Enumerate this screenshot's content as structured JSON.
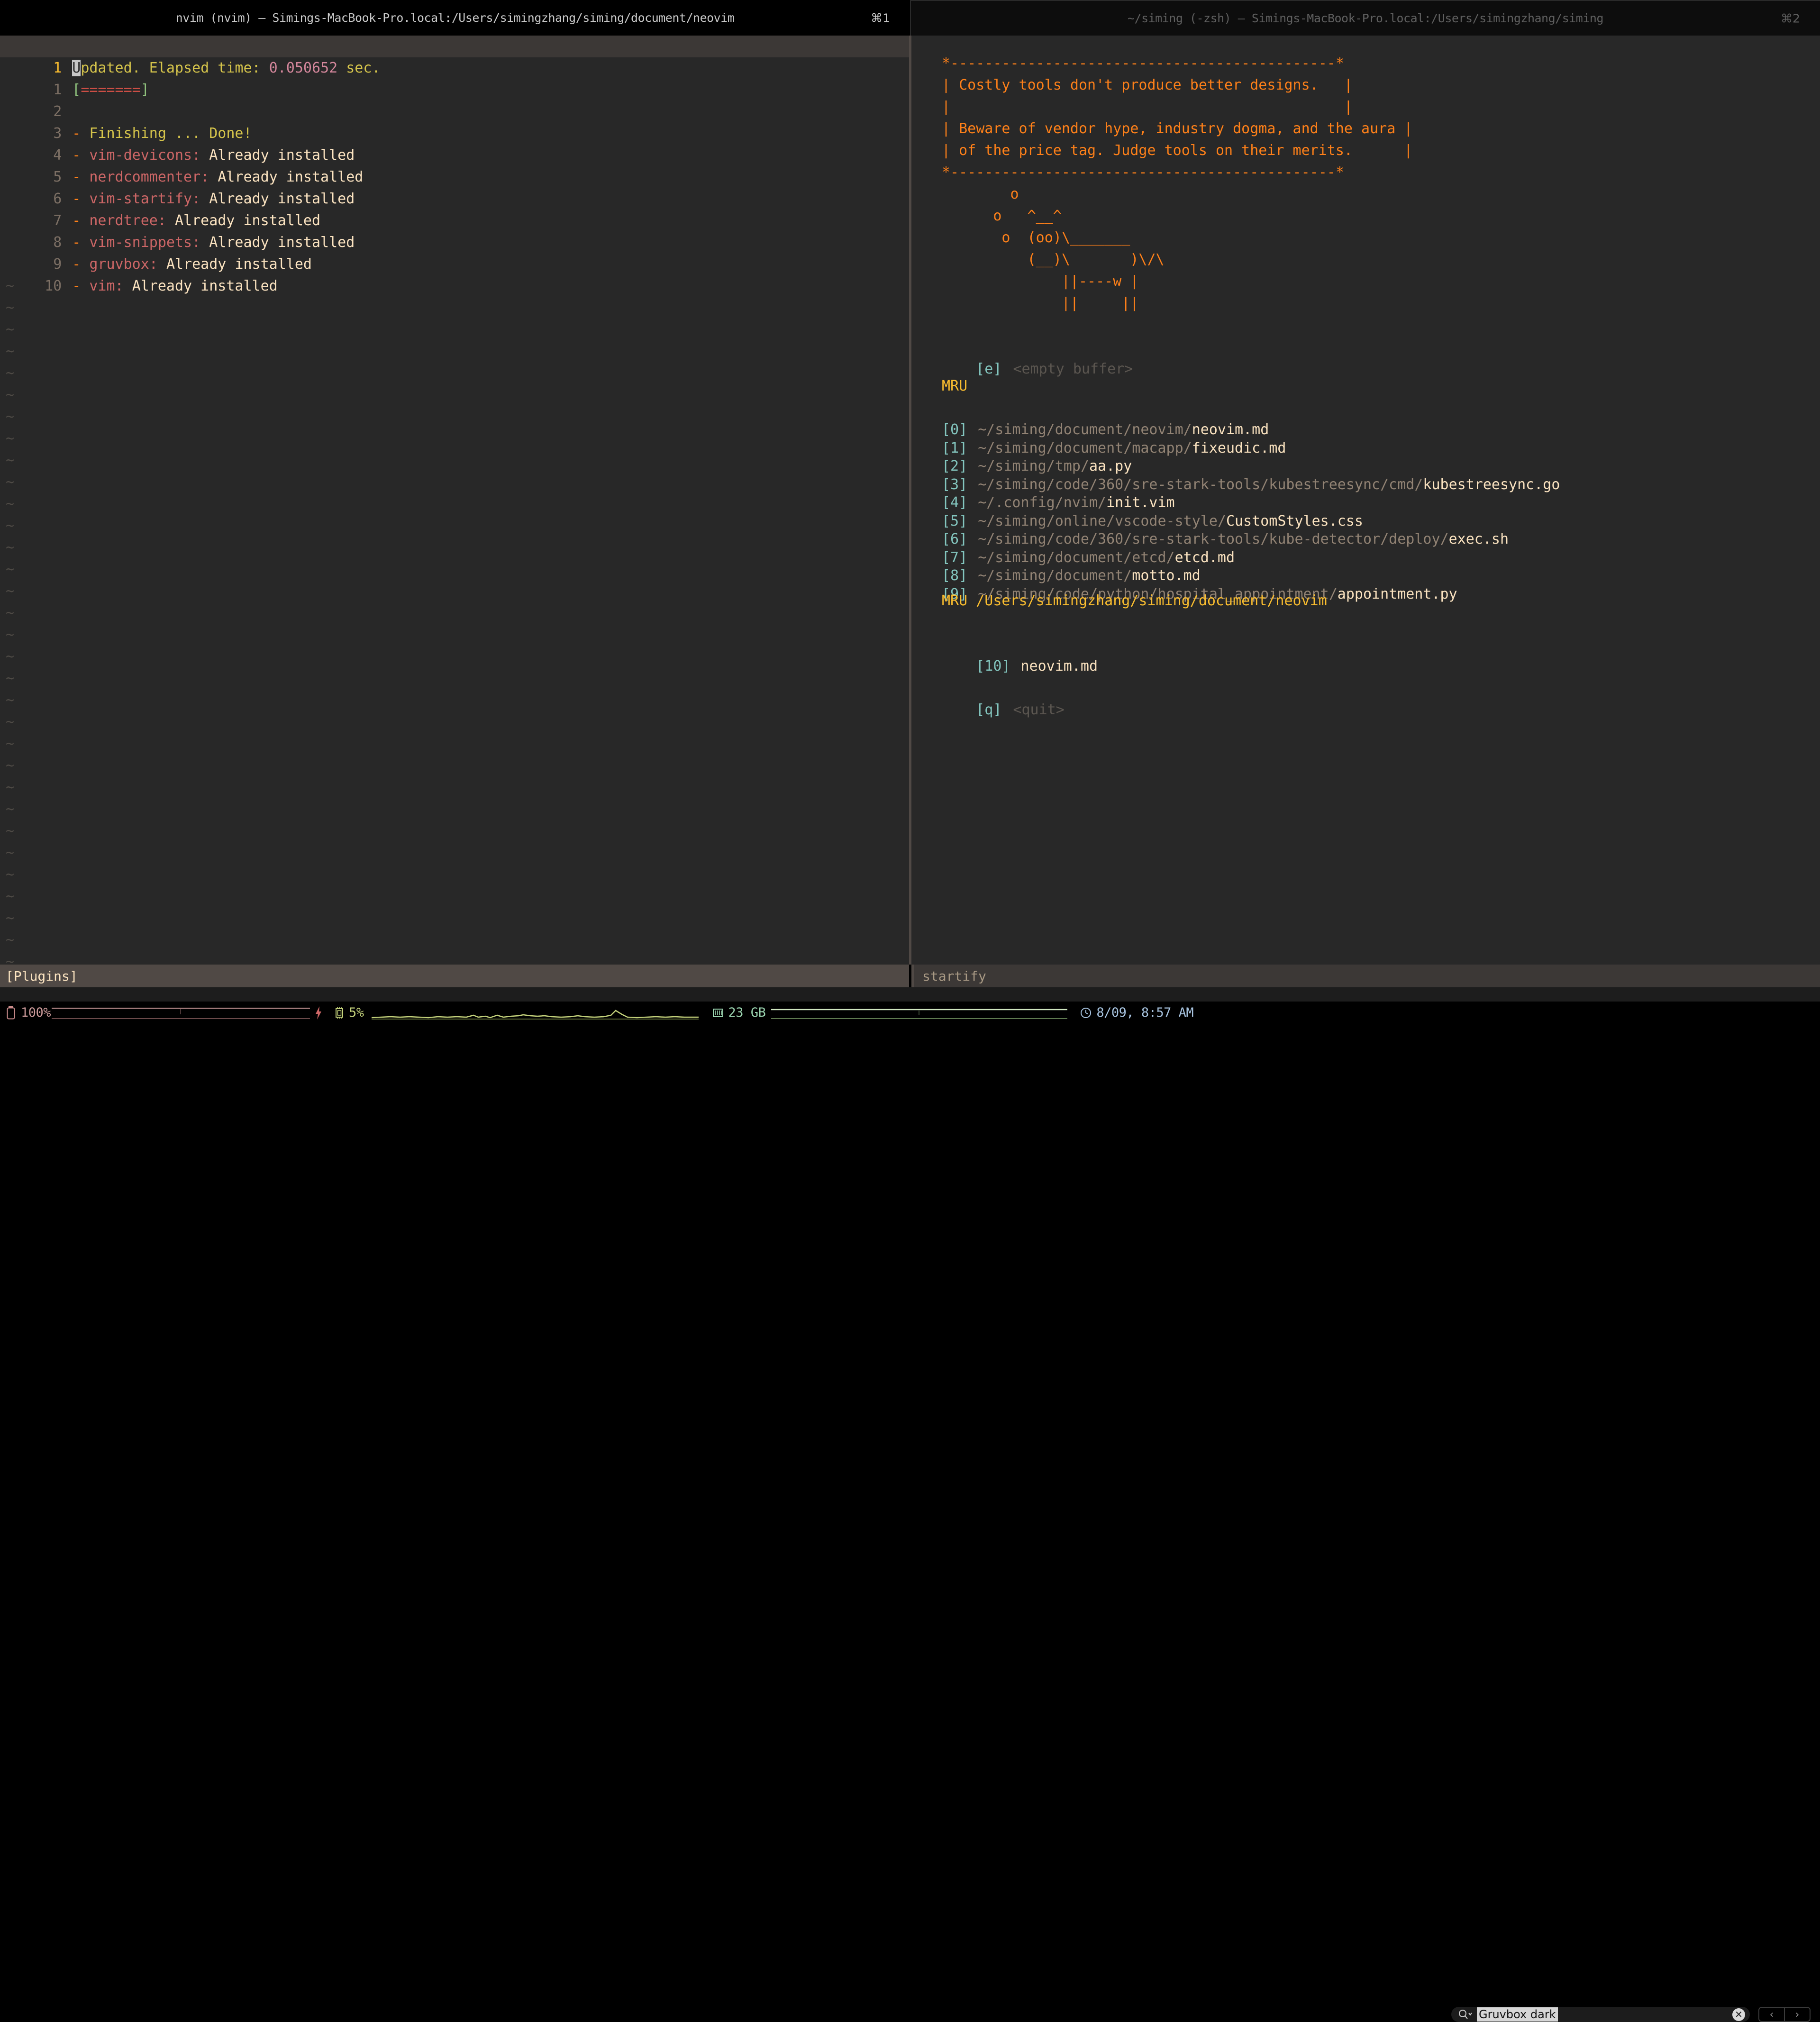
{
  "windows": {
    "left": {
      "title": "nvim (nvim) — Simings-MacBook-Pro.local:/Users/simingzhang/siming/document/neovim",
      "badge": "⌘1",
      "statusline": "[Plugins]"
    },
    "right": {
      "title": "~/siming (-zsh) — Simings-MacBook-Pro.local:/Users/simingzhang/siming",
      "badge": "⌘2",
      "statusline": "startify"
    }
  },
  "editor": {
    "cursor_line": {
      "number": "1",
      "cursor_char": "U",
      "text_after_cursor": "pdated. Elapsed time: ",
      "elapsed": "0.050652",
      "suffix": " sec."
    },
    "lines": [
      {
        "number": "1",
        "bracket_open": "[",
        "bars": "=======",
        "bracket_close": "]"
      },
      {
        "number": "2",
        "empty": true
      },
      {
        "number": "3",
        "dash": "-",
        "name": "Finishing ...",
        "status": "Done!"
      },
      {
        "number": "4",
        "dash": "-",
        "name": "vim-devicons:",
        "status": "Already installed"
      },
      {
        "number": "5",
        "dash": "-",
        "name": "nerdcommenter:",
        "status": "Already installed"
      },
      {
        "number": "6",
        "dash": "-",
        "name": "vim-startify:",
        "status": "Already installed"
      },
      {
        "number": "7",
        "dash": "-",
        "name": "nerdtree:",
        "status": "Already installed"
      },
      {
        "number": "8",
        "dash": "-",
        "name": "vim-snippets:",
        "status": "Already installed"
      },
      {
        "number": "9",
        "dash": "-",
        "name": "gruvbox:",
        "status": "Already installed"
      },
      {
        "number": "10",
        "dash": "-",
        "name": "vim:",
        "status": "Already installed"
      }
    ],
    "filler_char": "~"
  },
  "startify": {
    "header_box": [
      "*---------------------------------------------*",
      "| Costly tools don't produce better designs.  |",
      "|                                             |",
      "| Beware of vendor hype, industry dogma, and the aura |",
      "| of the price tag. Judge tools on their merits.      |",
      "*---------------------------------------------*"
    ],
    "header_lines": {
      "top": "*---------------------------------------------*",
      "l1": "| Costly tools don't produce better designs.   |",
      "l2": "|                                              |",
      "l3": "| Beware of vendor hype, industry dogma, and the aura |",
      "l4": "| of the price tag. Judge tools on their merits.      |",
      "bottom": "*---------------------------------------------*"
    },
    "cow_art": [
      "        o",
      "      o   ^__^",
      "       o  (oo)\\_______",
      "          (__)\\       )\\/\\",
      "              ||----w |",
      "              ||     ||"
    ],
    "empty_buffer": {
      "key": "[e]",
      "label": "<empty buffer>"
    },
    "mru_heading": "MRU",
    "mru_items": [
      {
        "key": "[0]",
        "dir": "~/siming/document/neovim/",
        "file": "neovim.md"
      },
      {
        "key": "[1]",
        "dir": "~/siming/document/macapp/",
        "file": "fixeudic.md"
      },
      {
        "key": "[2]",
        "dir": "~/siming/tmp/",
        "file": "aa.py"
      },
      {
        "key": "[3]",
        "dir": "~/siming/code/360/sre-stark-tools/kubestreesync/cmd/",
        "file": "kubestreesync.go"
      },
      {
        "key": "[4]",
        "dir": "~/.config/nvim/",
        "file": "init.vim"
      },
      {
        "key": "[5]",
        "dir": "~/siming/online/vscode-style/",
        "file": "CustomStyles.css"
      },
      {
        "key": "[6]",
        "dir": "~/siming/code/360/sre-stark-tools/kube-detector/deploy/",
        "file": "exec.sh"
      },
      {
        "key": "[7]",
        "dir": "~/siming/document/etcd/",
        "file": "etcd.md"
      },
      {
        "key": "[8]",
        "dir": "~/siming/document/",
        "file": "motto.md"
      },
      {
        "key": "[9]",
        "dir": "~/siming/code/python/hospital_appointment/",
        "file": "appointment.py"
      }
    ],
    "mru_dir_heading": "MRU /Users/simingzhang/siming/document/neovim",
    "mru_dir_items": [
      {
        "key": "[10]",
        "file": "neovim.md"
      }
    ],
    "quit": {
      "key": "[q]",
      "label": "<quit>"
    }
  },
  "dock": {
    "battery": {
      "icon": "battery-icon",
      "value": "100%",
      "charging_icon": "bolt-icon"
    },
    "cpu": {
      "icon": "cpu-chip-icon",
      "value": "5%"
    },
    "memory": {
      "icon": "memory-icon",
      "value": "23 GB"
    },
    "clock": {
      "icon": "clock-icon",
      "value": "8/09, 8:57 AM"
    },
    "search": {
      "icon": "search-icon",
      "value": "Gruvbox dark",
      "placeholder": "Search",
      "clear_icon": "clear-icon"
    },
    "nav": {
      "prev": "‹",
      "next": "›"
    }
  },
  "colors": {
    "bg": "#282828",
    "cursorline": "#3c3836",
    "orange": "#fe8019",
    "yellow": "#d5c44b",
    "amber": "#fabd2f",
    "red": "#cc4e45",
    "cream": "#fbe3c0",
    "gray": "#928374",
    "teal": "#83c5be",
    "purple": "#d3869b",
    "green": "#8ec07c",
    "statusbar_active": "#504945",
    "statusbar_inactive": "#3c3836"
  }
}
